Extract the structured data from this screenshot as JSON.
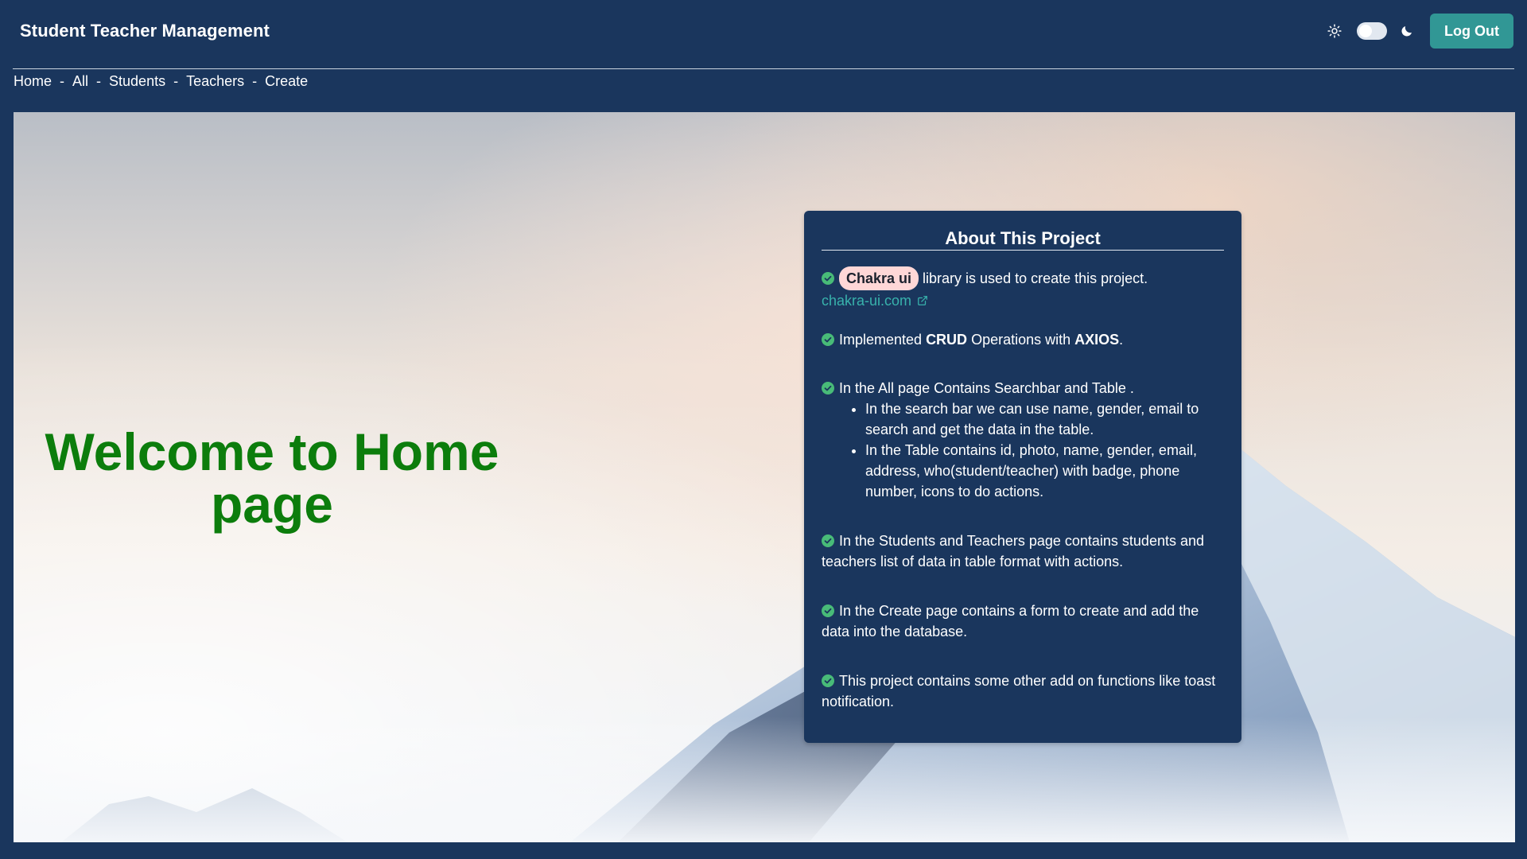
{
  "header": {
    "brand": "Student Teacher Management",
    "logout_label": "Log Out",
    "icons": {
      "light": "sun-icon",
      "toggle": "theme-toggle",
      "dark": "moon-icon"
    }
  },
  "breadcrumb": {
    "items": [
      "Home",
      "All",
      "Students",
      "Teachers",
      "Create"
    ],
    "separator": "-"
  },
  "hero": {
    "welcome_line1": "Welcome to Home",
    "welcome_line2": "page"
  },
  "about": {
    "title": "About This Project",
    "item1": {
      "badge": "Chakra ui",
      "text": " library is used to create this project.",
      "link": "chakra-ui.com"
    },
    "item2": {
      "prefix": "Implemented ",
      "bold1": "CRUD",
      "middle": " Operations with ",
      "bold2": "AXIOS",
      "suffix": "."
    },
    "item3": {
      "text": "In the All page Contains Searchbar and Table .",
      "sub1": "In the search bar we can use name, gender, email to search and get the data in the table.",
      "sub2": "In the Table contains id, photo, name, gender, email, address, who(student/teacher) with badge, phone number, icons to do actions."
    },
    "item4": {
      "text": "In the Students and Teachers page contains students and teachers list of data in table format with actions."
    },
    "item5": {
      "text": "In the Create page contains a form to create and add the data into the database."
    },
    "item6": {
      "text": "This project contains some other add on functions like toast notification."
    }
  },
  "colors": {
    "background": "#1a365d",
    "accent": "#319795",
    "welcome_text": "#0c7d0c",
    "check": "#48bb78",
    "badge_bg": "#fed7d7",
    "link": "#38b2ac"
  }
}
